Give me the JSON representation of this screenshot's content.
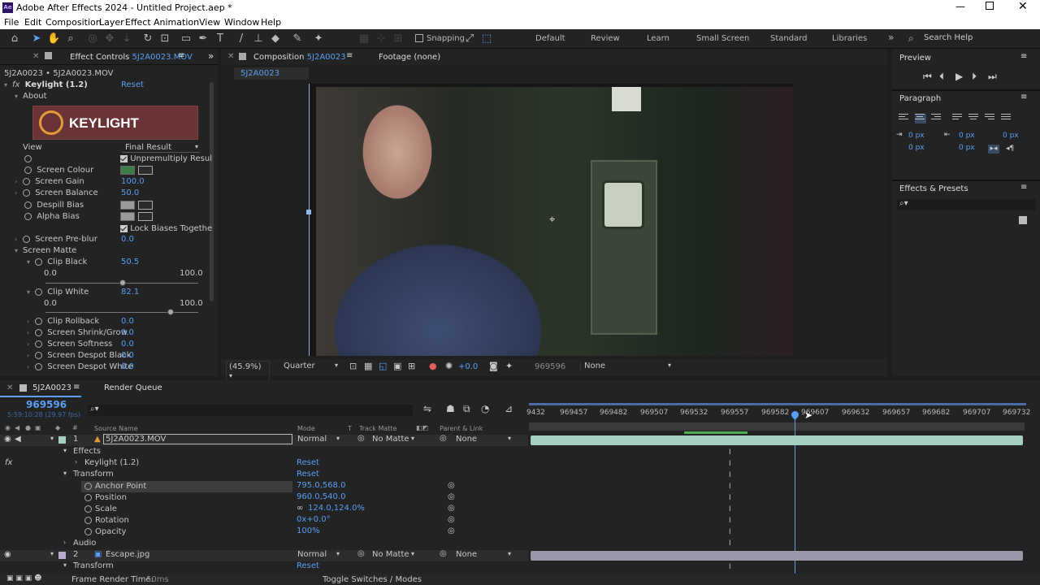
{
  "app": {
    "title": "Adobe After Effects 2024 - Untitled Project.aep *",
    "logo": "Ae"
  },
  "menu": [
    "File",
    "Edit",
    "Composition",
    "Layer",
    "Effect",
    "Animation",
    "View",
    "Window",
    "Help"
  ],
  "toolbar": {
    "snapping": "Snapping",
    "workspaces": [
      "Default",
      "Review",
      "Learn",
      "Small Screen",
      "Standard",
      "Libraries"
    ],
    "search_placeholder": "Search Help"
  },
  "effect_controls": {
    "tab_label": "Effect Controls",
    "tab_layer": "5J2A0023.MOV",
    "breadcrumb": "5J2A0023 • 5J2A0023.MOV",
    "effect_name": "Keylight (1.2)",
    "reset": "Reset",
    "about": "About",
    "logo_text": "KEYLIGHT",
    "view_label": "View",
    "view_value": "Final Result",
    "unpremultiply": "Unpremultiply Resul",
    "screen_colour": "Screen Colour",
    "screen_colour_value": "#3f7a4c",
    "screen_gain": "Screen Gain",
    "screen_gain_value": "100.0",
    "screen_balance": "Screen Balance",
    "screen_balance_value": "50.0",
    "despill_bias": "Despill Bias",
    "alpha_bias": "Alpha Bias",
    "lock_biases": "Lock Biases Togethe",
    "screen_preblur": "Screen Pre-blur",
    "screen_preblur_value": "0.0",
    "screen_matte": "Screen Matte",
    "clip_black": "Clip Black",
    "clip_black_value": "50.5",
    "clip_black_min": "0.0",
    "clip_black_max": "100.0",
    "clip_black_frac": 0.505,
    "clip_white": "Clip White",
    "clip_white_value": "82.1",
    "clip_white_min": "0.0",
    "clip_white_max": "100.0",
    "clip_white_frac": 0.821,
    "clip_rollback": "Clip Rollback",
    "clip_rollback_value": "0.0",
    "screen_shrink": "Screen Shrink/Grow",
    "screen_shrink_value": "0.0",
    "screen_softness": "Screen Softness",
    "screen_softness_value": "0.0",
    "screen_despot_black": "Screen Despot Black",
    "screen_despot_black_value": "0.0",
    "screen_despot_white": "Screen Despot White",
    "screen_despot_white_value": "0.0"
  },
  "composition": {
    "tab_label": "Composition",
    "tab_comp": "5J2A0023",
    "footage_tab": "Footage (none)",
    "comp_chip": "5J2A0023",
    "zoom": "(45.9%)",
    "resolution": "Quarter",
    "exposure": "+0.0",
    "timecode": "969596",
    "view_option": "None"
  },
  "preview": {
    "title": "Preview"
  },
  "paragraph": {
    "title": "Paragraph",
    "values": [
      "0 px",
      "0 px",
      "0 px",
      "0 px",
      "0 px"
    ]
  },
  "effects_presets": {
    "title": "Effects & Presets"
  },
  "timeline": {
    "tab_label": "5J2A0023",
    "render_queue": "Render Queue",
    "current_time": "969596",
    "time_sub": "5:59:10:28 (29.97 fps)",
    "columns": {
      "source": "Source Name",
      "mode": "Mode",
      "t": "T",
      "track_matte": "Track Matte",
      "parent": "Parent & Link"
    },
    "ruler": [
      "9432",
      "969457",
      "969482",
      "969507",
      "969532",
      "969557",
      "969582",
      "969607",
      "969632",
      "969657",
      "969682",
      "969707",
      "969732"
    ],
    "layer1": {
      "num": "1",
      "name": "5J2A0023.MOV",
      "mode": "Normal",
      "matte": "No Matte",
      "parent": "None"
    },
    "effects": "Effects",
    "keylight": "Keylight (1.2)",
    "transform": "Transform",
    "reset": "Reset",
    "anchor": "Anchor Point",
    "anchor_value": "795.0,568.0",
    "position": "Position",
    "position_value": "960.0,540.0",
    "scale": "Scale",
    "scale_value": "124.0,124.0%",
    "rotation": "Rotation",
    "rotation_value": "0x+0.0°",
    "opacity": "Opacity",
    "opacity_value": "100%",
    "audio": "Audio",
    "layer2": {
      "num": "2",
      "name": "Escape.jpg",
      "mode": "Normal",
      "matte": "No Matte",
      "parent": "None"
    },
    "transform2": "Transform",
    "frame_render": "Frame Render Time:",
    "frame_render_value": "50ms",
    "toggle": "Toggle Switches / Modes"
  }
}
